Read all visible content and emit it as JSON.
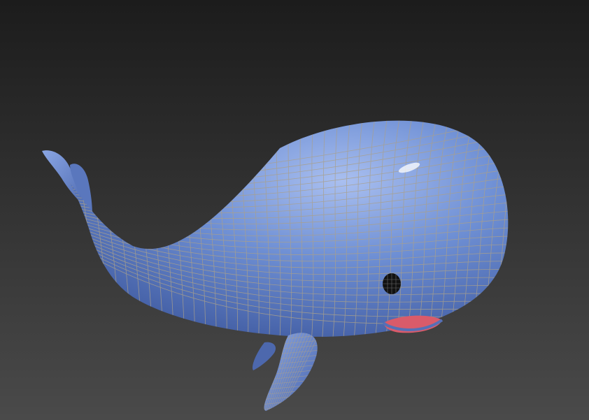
{
  "scene": {
    "subject": "whale-3d-model",
    "colors": {
      "background_top": "#1c1c1c",
      "background_bottom": "#4a4a4a",
      "body": "#6e8fd4",
      "body_shadow": "#3f5aa0",
      "body_highlight": "#a9bff0",
      "wireframe": "#a9a08c",
      "mouth": "#d95b6a",
      "eye": "#111111",
      "specular": "#ffffff"
    }
  }
}
